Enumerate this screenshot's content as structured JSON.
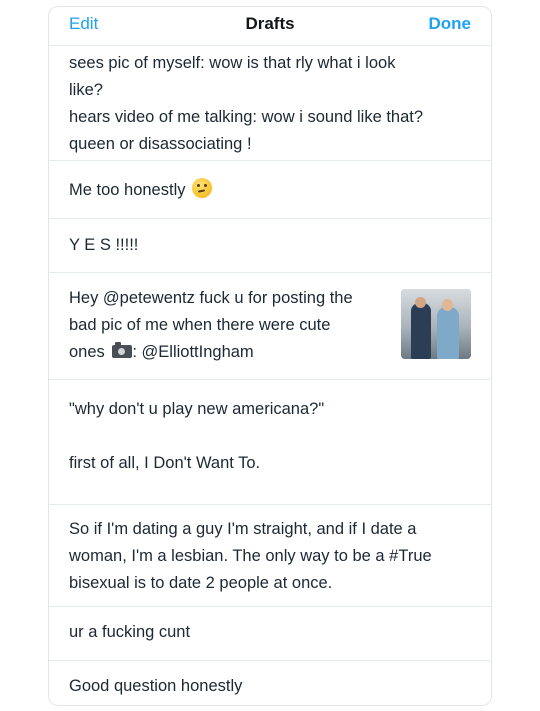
{
  "header": {
    "edit_label": "Edit",
    "title": "Drafts",
    "done_label": "Done"
  },
  "drafts": [
    {
      "lines": [
        "sees pic of myself: wow is that rly what i look",
        "like?",
        "hears video of me talking: wow i sound like that?",
        "queen or disassociating !"
      ]
    },
    {
      "text": "Me too honestly",
      "icon": "thinking-face-emoji"
    },
    {
      "text": "Y E S !!!!!"
    },
    {
      "lines": [
        "Hey @petewentz fuck u for posting the",
        "bad pic of me when there were cute"
      ],
      "line3_prefix": "ones",
      "line3_icon": "camera-icon",
      "line3_suffix": ": @ElliottIngham",
      "has_thumbnail": true
    },
    {
      "lines": [
        "\"why don't u play new americana?\"",
        "",
        "first of all, I Don't Want To."
      ]
    },
    {
      "lines": [
        "So if I'm dating a guy I'm straight, and if I date a",
        "woman, I'm a lesbian. The only way to be a #True",
        "bisexual is to date 2 people at once."
      ]
    },
    {
      "text": "ur a fucking cunt"
    },
    {
      "text": "Good question honestly"
    }
  ],
  "colors": {
    "accent": "#1da1f2",
    "text": "#1c2833",
    "divider": "#e6ecf0"
  }
}
